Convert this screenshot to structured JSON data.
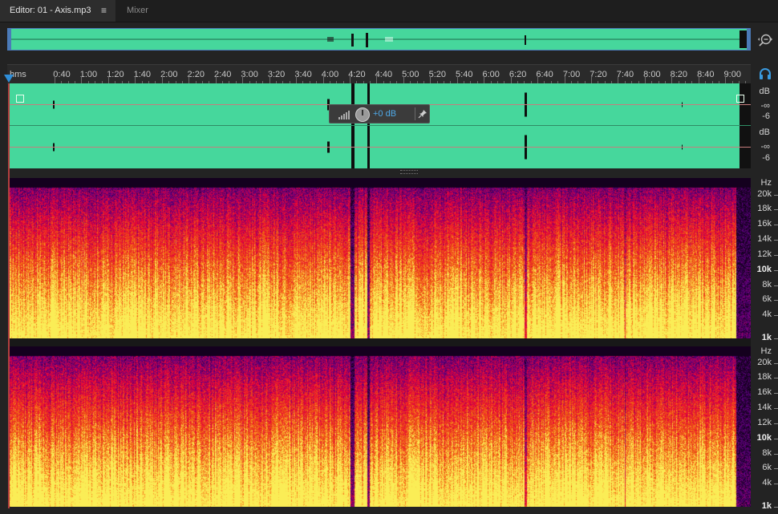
{
  "tabs": {
    "editor_label": "Editor: 01 - Axis.mp3",
    "menu_icon": "≡",
    "mixer_label": "Mixer"
  },
  "ruler": {
    "units": "hms",
    "ticks": [
      "0:40",
      "1:00",
      "1:20",
      "1:40",
      "2:00",
      "2:20",
      "2:40",
      "3:00",
      "3:20",
      "3:40",
      "4:00",
      "4:20",
      "4:40",
      "5:00",
      "5:20",
      "5:40",
      "6:00",
      "6:20",
      "6:40",
      "7:00",
      "7:20",
      "7:40",
      "8:00",
      "8:20",
      "8:40",
      "9:00"
    ]
  },
  "hud": {
    "gain": "+0 dB",
    "icons": [
      "signal-bars-icon",
      "volume-knob-icon",
      "pin-icon"
    ]
  },
  "db_scale": {
    "channel1": [
      "dB",
      "-∞",
      "-6"
    ],
    "channel2": [
      "dB",
      "-∞",
      "-6"
    ]
  },
  "hz_scale": {
    "labels": [
      "Hz",
      "20k",
      "18k",
      "16k",
      "14k",
      "12k",
      "10k",
      "8k",
      "6k",
      "4k",
      "1k"
    ]
  },
  "colors": {
    "waveform": "#46d79c",
    "accent": "#2f8ed8",
    "hud_value": "#4fa9e8"
  }
}
